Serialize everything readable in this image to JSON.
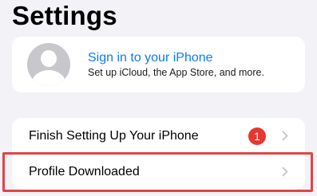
{
  "header": {
    "title": "Settings"
  },
  "account": {
    "sign_in_label": "Sign in to your iPhone",
    "subtitle": "Set up iCloud, the App Store, and more.",
    "avatar_icon": "person-placeholder-icon"
  },
  "list": {
    "items": [
      {
        "label": "Finish Setting Up Your iPhone",
        "badge": "1",
        "icon": "chevron-right-icon"
      },
      {
        "label": "Profile Downloaded",
        "icon": "chevron-right-icon"
      }
    ]
  },
  "colors": {
    "accent": "#0a7aff",
    "badge": "#e5382f",
    "highlight": "#e04545",
    "background": "#f2f2f7"
  }
}
